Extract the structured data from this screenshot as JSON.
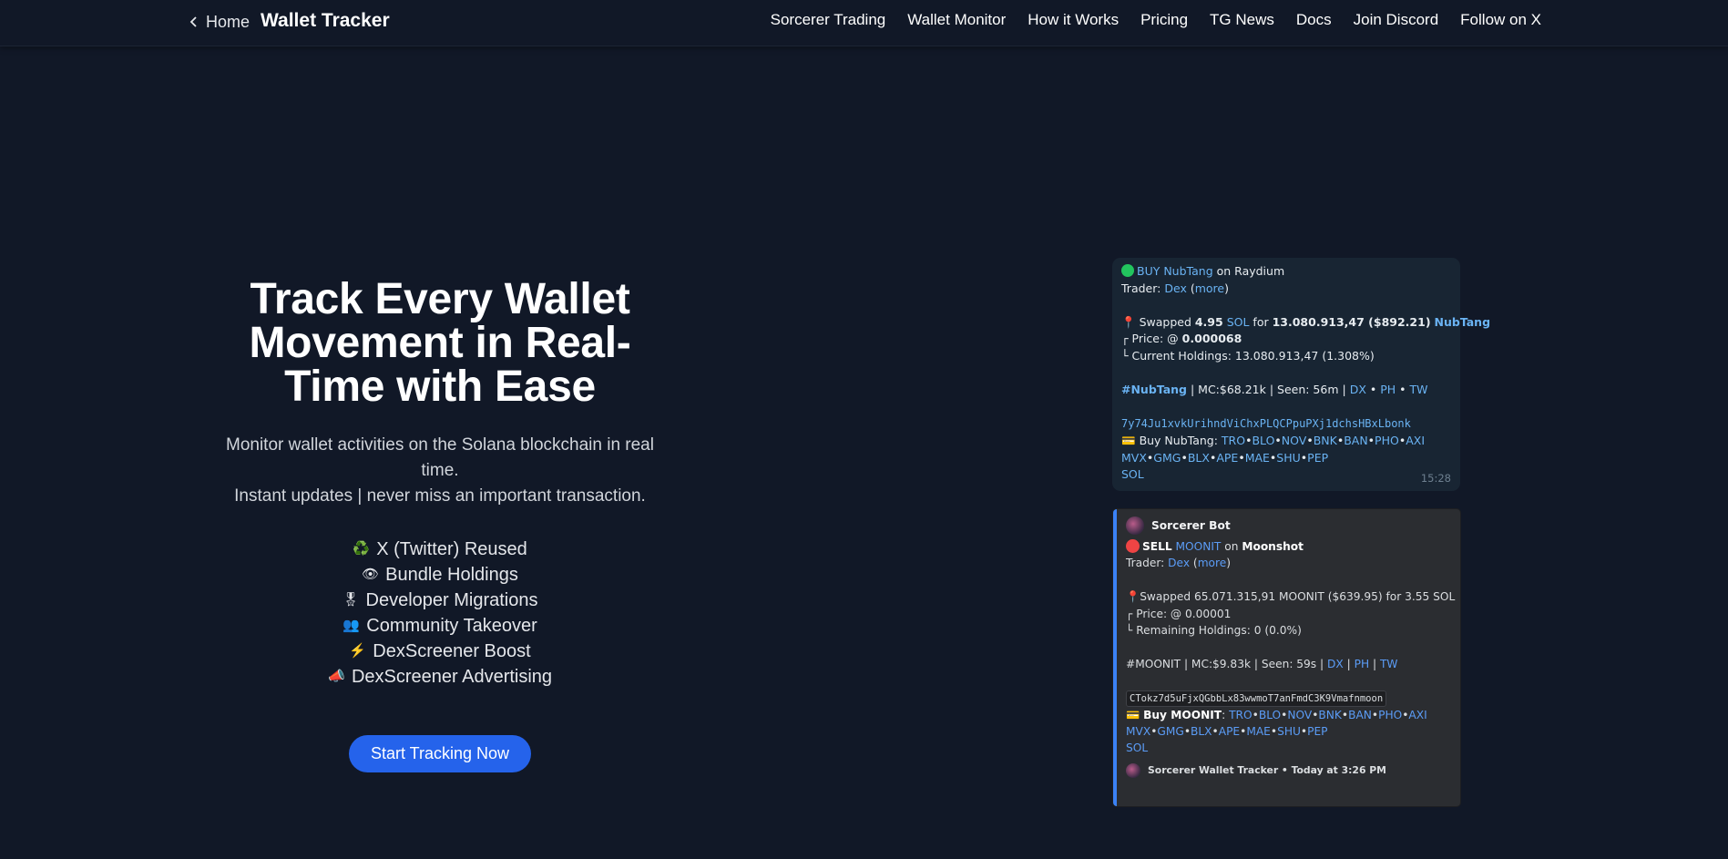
{
  "header": {
    "back_label": "Home",
    "brand": "Wallet Tracker",
    "nav": [
      "Sorcerer Trading",
      "Wallet Monitor",
      "How it Works",
      "Pricing",
      "TG News",
      "Docs",
      "Join Discord",
      "Follow on X"
    ]
  },
  "hero": {
    "title": "Track Every Wallet Movement in Real-Time with Ease",
    "subtitle_line1": "Monitor wallet activities on the Solana blockchain in real time.",
    "subtitle_line2": "Instant updates | never miss an important transaction.",
    "features": [
      {
        "icon": "♻️",
        "label": "X (Twitter) Reused"
      },
      {
        "icon": "👁",
        "label": "Bundle Holdings"
      },
      {
        "icon": "🎖",
        "label": "Developer Migrations"
      },
      {
        "icon": "👥",
        "label": "Community Takeover"
      },
      {
        "icon": "⚡",
        "label": "DexScreener Boost"
      },
      {
        "icon": "📣",
        "label": "DexScreener Advertising"
      }
    ],
    "cta": "Start Tracking Now"
  },
  "telegram": {
    "buy_label": "BUY NubTang",
    "on_text": "on Raydium",
    "trader_prefix": "Trader:",
    "trader_name": "Dex",
    "trader_more": "more",
    "swapped_prefix": "Swapped",
    "swapped_amount": "4.95",
    "swapped_token": "SOL",
    "swapped_for": "for",
    "swapped_result": "13.080.913,47 ($892.21)",
    "swapped_target": "NubTang",
    "price_prefix": "┌ Price: @",
    "price_value": "0.000068",
    "holdings": "└ Current Holdings: 13.080.913,47 (1.308%)",
    "hashtag": "#NubTang",
    "stats": "| MC:$68.21k | Seen: 56m |",
    "link_dx": "DX",
    "link_ph": "PH",
    "link_tw": "TW",
    "address": "7y74Ju1xvkUrihndViChxPLQCPpuPXj1dchsHBxLbonk",
    "buy_prefix": "Buy NubTang:",
    "exchanges_1": [
      "TRO",
      "BLO",
      "NOV",
      "BNK",
      "BAN",
      "PHO",
      "AXI"
    ],
    "exchanges_2": [
      "MVX",
      "GMG",
      "BLX",
      "APE",
      "MAE",
      "SHU",
      "PEP"
    ],
    "exchange_last": "SOL",
    "time": "15:28"
  },
  "discord": {
    "bot_name": "Sorcerer Bot",
    "sell_label": "SELL",
    "token": "MOONIT",
    "on_word": "on",
    "venue": "Moonshot",
    "trader_prefix": "Trader:",
    "trader_name": "Dex",
    "trader_more": "more",
    "swapped": "Swapped 65.071.315,91 MOONIT ($639.95) for 3.55 SOL",
    "price": "┌ Price: @ 0.00001",
    "holdings": "└ Remaining Holdings: 0 (0.0%)",
    "stats": "#MOONIT | MC:$9.83k | Seen: 59s |",
    "link_dx": "DX",
    "link_ph": "PH",
    "link_tw": "TW",
    "address": "CTokz7d5uFjxQGbbLx83wwmoT7anFmdC3K9Vmafnmoon",
    "buy_prefix": "Buy MOONIT",
    "exchanges_1": [
      "TRO",
      "BLO",
      "NOV",
      "BNK",
      "BAN",
      "PHO",
      "AXI"
    ],
    "exchanges_2": [
      "MVX",
      "GMG",
      "BLX",
      "APE",
      "MAE",
      "SHU",
      "PEP"
    ],
    "exchange_last": "SOL",
    "footer": "Sorcerer Wallet Tracker • Today at 3:26 PM"
  }
}
